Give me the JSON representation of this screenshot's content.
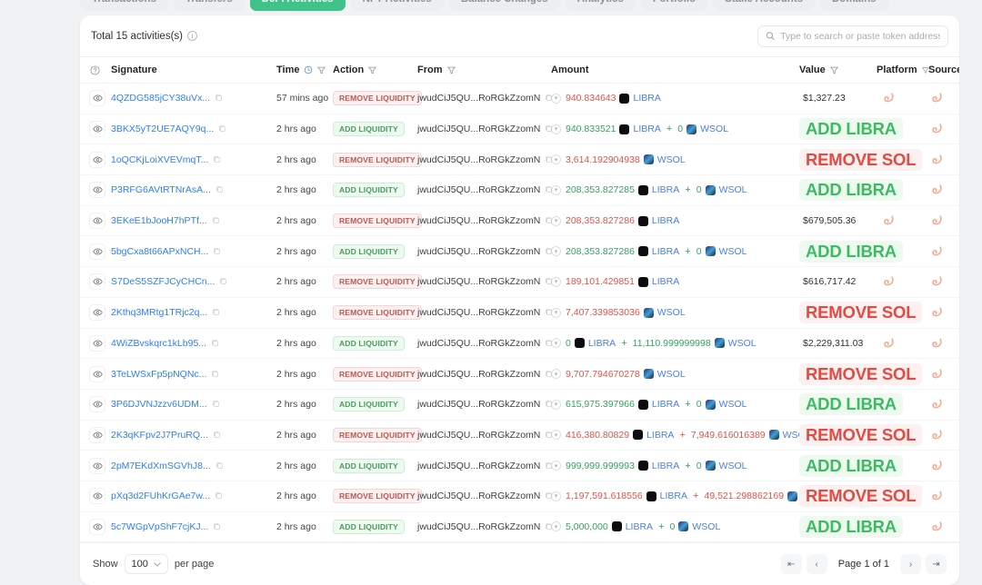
{
  "tabs": [
    {
      "label": "Transactions",
      "active": false
    },
    {
      "label": "Transfers",
      "active": false
    },
    {
      "label": "DeFi Activities",
      "active": true
    },
    {
      "label": "NFT Activities",
      "active": false
    },
    {
      "label": "Balance Changes",
      "active": false
    },
    {
      "label": "Analytics",
      "active": false
    },
    {
      "label": "Portfolio",
      "active": false
    },
    {
      "label": "Stake Accounts",
      "active": false
    },
    {
      "label": "Domains",
      "active": false
    }
  ],
  "header": {
    "total_label": "Total 15 activities(s)",
    "info_icon": "info-icon",
    "search_placeholder": "Type to search or paste token address",
    "search_value": "",
    "search_icon": "search-icon"
  },
  "columns": [
    {
      "key": "eye",
      "label": "",
      "icon": "help-circle-icon",
      "filter": false
    },
    {
      "key": "signature",
      "label": "Signature",
      "filter": false
    },
    {
      "key": "time",
      "label": "Time",
      "clock": true,
      "filter": true
    },
    {
      "key": "action",
      "label": "Action",
      "filter": true
    },
    {
      "key": "from",
      "label": "From",
      "filter": true
    },
    {
      "key": "amount",
      "label": "Amount",
      "filter": false
    },
    {
      "key": "value",
      "label": "Value",
      "filter": true
    },
    {
      "key": "platform",
      "label": "Platform",
      "filter": true
    },
    {
      "key": "source",
      "label": "Source",
      "filter": true
    }
  ],
  "colors": {
    "accent_green": "#3fc38a",
    "link_blue": "#2e7ef7",
    "token_blue": "#4b7fe0",
    "red": "#e2524a",
    "green": "#35a35f",
    "badge_remove_bg": "#fdf0f0",
    "badge_remove_fg": "#c0564f",
    "badge_add_bg": "#eefaf0",
    "badge_add_fg": "#4a9b5e",
    "big_add_fg": "#3dbb63",
    "big_remove_fg": "#e34b42",
    "page_bg": "#f1f2f4",
    "card_bg": "#ffffff"
  },
  "from_address": "jwudCiJ5QU...RoRGkZzomN",
  "rows": [
    {
      "signature": "4QZDG585jCY38uVx...",
      "time": "57 mins ago",
      "action": "REMOVE LIQUIDITY",
      "action_type": "remove",
      "from": "jwudCiJ5QU...RoRGkZzomN",
      "amount_parts": [
        {
          "num": "940.834643",
          "sign": "red",
          "token": "LIBRA",
          "token_kind": "libra"
        }
      ],
      "value": "$1,327.23",
      "value_kind": "usd",
      "platform_icon": "meteora-icon",
      "source_icon": "meteora-icon"
    },
    {
      "signature": "3BKX5yT2UE7AQY9q...",
      "time": "2 hrs ago",
      "action": "ADD LIQUIDITY",
      "action_type": "add",
      "from": "jwudCiJ5QU...RoRGkZzomN",
      "amount_parts": [
        {
          "num": "940.833521",
          "sign": "green",
          "token": "LIBRA",
          "token_kind": "libra"
        },
        {
          "num": "0",
          "sign": "green",
          "token": "WSOL",
          "token_kind": "wsol"
        }
      ],
      "value": "ADD LIBRA",
      "value_kind": "add",
      "platform_icon": "meteora-icon",
      "source_icon": "meteora-icon"
    },
    {
      "signature": "1oQCKjLoiXVEVmqT...",
      "time": "2 hrs ago",
      "action": "REMOVE LIQUIDITY",
      "action_type": "remove",
      "from": "jwudCiJ5QU...RoRGkZzomN",
      "amount_parts": [
        {
          "num": "3,614.192904938",
          "sign": "red",
          "token": "WSOL",
          "token_kind": "wsol"
        }
      ],
      "value": "REMOVE SOL",
      "value_kind": "remove",
      "platform_icon": "meteora-icon",
      "source_icon": "meteora-icon"
    },
    {
      "signature": "P3RFG6AVtRTNrAsA...",
      "time": "2 hrs ago",
      "action": "ADD LIQUIDITY",
      "action_type": "add",
      "from": "jwudCiJ5QU...RoRGkZzomN",
      "amount_parts": [
        {
          "num": "208,353.827285",
          "sign": "green",
          "token": "LIBRA",
          "token_kind": "libra"
        },
        {
          "num": "0",
          "sign": "green",
          "token": "WSOL",
          "token_kind": "wsol"
        }
      ],
      "value": "ADD LIBRA",
      "value_kind": "add",
      "platform_icon": "meteora-icon",
      "source_icon": "meteora-icon"
    },
    {
      "signature": "3EKeE1bJooH7hPTf...",
      "time": "2 hrs ago",
      "action": "REMOVE LIQUIDITY",
      "action_type": "remove",
      "from": "jwudCiJ5QU...RoRGkZzomN",
      "amount_parts": [
        {
          "num": "208,353.827286",
          "sign": "red",
          "token": "LIBRA",
          "token_kind": "libra"
        }
      ],
      "value": "$679,505.36",
      "value_kind": "usd",
      "platform_icon": "meteora-icon",
      "source_icon": "meteora-icon"
    },
    {
      "signature": "5bgCxa8t66APxNCH...",
      "time": "2 hrs ago",
      "action": "ADD LIQUIDITY",
      "action_type": "add",
      "from": "jwudCiJ5QU...RoRGkZzomN",
      "amount_parts": [
        {
          "num": "208,353.827286",
          "sign": "green",
          "token": "LIBRA",
          "token_kind": "libra"
        },
        {
          "num": "0",
          "sign": "green",
          "token": "WSOL",
          "token_kind": "wsol"
        }
      ],
      "value": "ADD LIBRA",
      "value_kind": "add",
      "platform_icon": "meteora-icon",
      "source_icon": "meteora-icon"
    },
    {
      "signature": "S7DeS5SZFJCyCHCn...",
      "time": "2 hrs ago",
      "action": "REMOVE LIQUIDITY",
      "action_type": "remove",
      "from": "jwudCiJ5QU...RoRGkZzomN",
      "amount_parts": [
        {
          "num": "189,101.429851",
          "sign": "red",
          "token": "LIBRA",
          "token_kind": "libra"
        }
      ],
      "value": "$616,717.42",
      "value_kind": "usd",
      "platform_icon": "meteora-icon",
      "source_icon": "meteora-icon"
    },
    {
      "signature": "2Kthq3MRtg1TRjc2q...",
      "time": "2 hrs ago",
      "action": "REMOVE LIQUIDITY",
      "action_type": "remove",
      "from": "jwudCiJ5QU...RoRGkZzomN",
      "amount_parts": [
        {
          "num": "7,407.339853036",
          "sign": "red",
          "token": "WSOL",
          "token_kind": "wsol"
        }
      ],
      "value": "REMOVE SOL",
      "value_kind": "remove",
      "platform_icon": "meteora-icon",
      "source_icon": "meteora-icon"
    },
    {
      "signature": "4WiZBvskqrc1kLb95...",
      "time": "2 hrs ago",
      "action": "ADD LIQUIDITY",
      "action_type": "add",
      "from": "jwudCiJ5QU...RoRGkZzomN",
      "amount_parts": [
        {
          "num": "0",
          "sign": "green",
          "token": "LIBRA",
          "token_kind": "libra"
        },
        {
          "num": "11,110.999999998",
          "sign": "green",
          "token": "WSOL",
          "token_kind": "wsol"
        }
      ],
      "value": "$2,229,311.03",
      "value_kind": "usd",
      "platform_icon": "meteora-icon",
      "source_icon": "meteora-icon"
    },
    {
      "signature": "3TeLWSxFp5pNQNc...",
      "time": "2 hrs ago",
      "action": "REMOVE LIQUIDITY",
      "action_type": "remove",
      "from": "jwudCiJ5QU...RoRGkZzomN",
      "amount_parts": [
        {
          "num": "9,707.794670278",
          "sign": "red",
          "token": "WSOL",
          "token_kind": "wsol"
        }
      ],
      "value": "REMOVE SOL",
      "value_kind": "remove",
      "platform_icon": "meteora-icon",
      "source_icon": "meteora-icon"
    },
    {
      "signature": "3P6DJVNJzzv6UDM...",
      "time": "2 hrs ago",
      "action": "ADD LIQUIDITY",
      "action_type": "add",
      "from": "jwudCiJ5QU...RoRGkZzomN",
      "amount_parts": [
        {
          "num": "615,975.397966",
          "sign": "green",
          "token": "LIBRA",
          "token_kind": "libra"
        },
        {
          "num": "0",
          "sign": "green",
          "token": "WSOL",
          "token_kind": "wsol"
        }
      ],
      "value": "ADD LIBRA",
      "value_kind": "add",
      "platform_icon": "meteora-icon",
      "source_icon": "meteora-icon"
    },
    {
      "signature": "2K3qKFpv2J7PruRQ...",
      "time": "2 hrs ago",
      "action": "REMOVE LIQUIDITY",
      "action_type": "remove",
      "from": "jwudCiJ5QU...RoRGkZzomN",
      "amount_parts": [
        {
          "num": "416,380.80829",
          "sign": "red",
          "token": "LIBRA",
          "token_kind": "libra"
        },
        {
          "num": "7,949.616016389",
          "sign": "red",
          "token": "WSOL",
          "token_kind": "wsol"
        }
      ],
      "value": "REMOVE SOL",
      "value_kind": "remove",
      "platform_icon": "meteora-icon",
      "source_icon": "meteora-icon"
    },
    {
      "signature": "2pM7EKdXmSGVhJ8...",
      "time": "2 hrs ago",
      "action": "ADD LIQUIDITY",
      "action_type": "add",
      "from": "jwudCiJ5QU...RoRGkZzomN",
      "amount_parts": [
        {
          "num": "999,999.999993",
          "sign": "green",
          "token": "LIBRA",
          "token_kind": "libra"
        },
        {
          "num": "0",
          "sign": "green",
          "token": "WSOL",
          "token_kind": "wsol"
        }
      ],
      "value": "ADD LIBRA",
      "value_kind": "add",
      "platform_icon": "meteora-icon",
      "source_icon": "meteora-icon"
    },
    {
      "signature": "pXq3d2FUhKrGAe7w...",
      "time": "2 hrs ago",
      "action": "REMOVE LIQUIDITY",
      "action_type": "remove",
      "from": "jwudCiJ5QU...RoRGkZzomN",
      "amount_parts": [
        {
          "num": "1,197,591.618556",
          "sign": "red",
          "token": "LIBRA",
          "token_kind": "libra"
        },
        {
          "num": "49,521.298862169",
          "sign": "red",
          "token": "WSOL",
          "token_kind": "wsol"
        }
      ],
      "value": "REMOVE SOL",
      "value_kind": "remove",
      "platform_icon": "meteora-icon",
      "source_icon": "meteora-icon"
    },
    {
      "signature": "5c7WGpVpShF7cjKJ...",
      "time": "2 hrs ago",
      "action": "ADD LIQUIDITY",
      "action_type": "add",
      "from": "jwudCiJ5QU...RoRGkZzomN",
      "amount_parts": [
        {
          "num": "5,000,000",
          "sign": "green",
          "token": "LIBRA",
          "token_kind": "libra"
        },
        {
          "num": "0",
          "sign": "green",
          "token": "WSOL",
          "token_kind": "wsol"
        }
      ],
      "value": "ADD LIBRA",
      "value_kind": "add",
      "platform_icon": "meteora-icon",
      "source_icon": "meteora-icon"
    }
  ],
  "footer": {
    "show_label": "Show",
    "per_page_value": "100",
    "per_page_label": "per page",
    "page_info": "Page 1 of 1",
    "first_icon": "first-page-icon",
    "prev_icon": "chevron-left-icon",
    "next_icon": "chevron-right-icon",
    "last_icon": "last-page-icon"
  }
}
